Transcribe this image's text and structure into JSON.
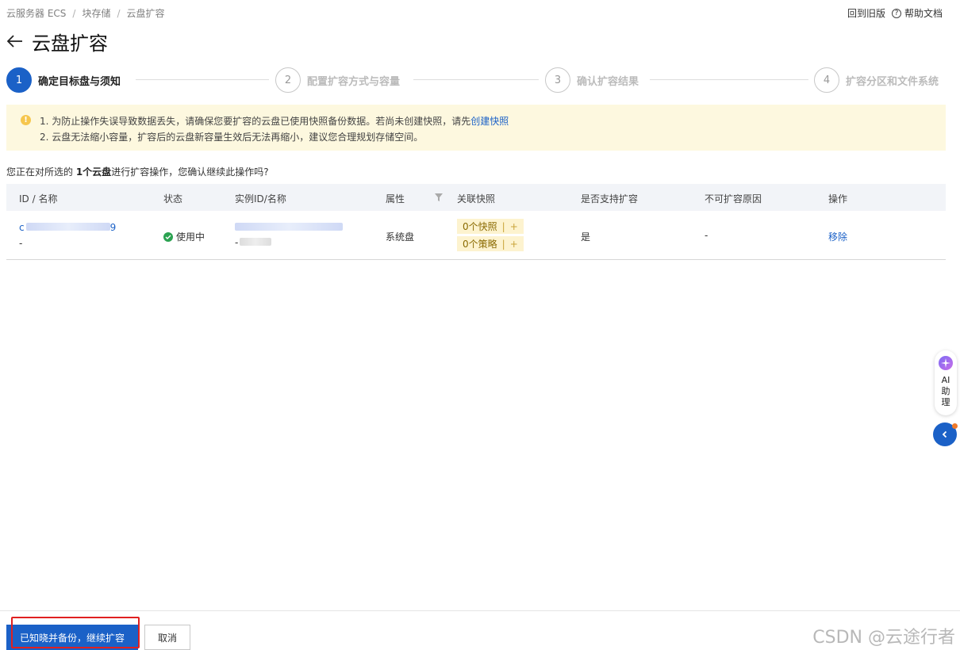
{
  "breadcrumb": [
    "云服务器 ECS",
    "块存储",
    "云盘扩容"
  ],
  "top_links": {
    "old_version": "回到旧版",
    "help_docs": "帮助文档"
  },
  "page_title": "云盘扩容",
  "steps": [
    {
      "num": "1",
      "label": "确定目标盘与须知"
    },
    {
      "num": "2",
      "label": "配置扩容方式与容量"
    },
    {
      "num": "3",
      "label": "确认扩容结果"
    },
    {
      "num": "4",
      "label": "扩容分区和文件系统"
    }
  ],
  "alert": {
    "line1_text": "1. 为防止操作失误导致数据丢失，请确保您要扩容的云盘已使用快照备份数据。若尚未创建快照，请先",
    "line1_link": "创建快照",
    "line2_text": "2. 云盘无法缩小容量，扩容后的云盘新容量生效后无法再缩小，建议您合理规划存储空间。"
  },
  "confirm": {
    "prefix": "您正在对所选的 ",
    "count": "1个云盘",
    "suffix": "进行扩容操作，您确认继续此操作吗?"
  },
  "table": {
    "headers": [
      "ID / 名称",
      "状态",
      "实例ID/名称",
      "属性",
      "关联快照",
      "是否支持扩容",
      "不可扩容原因",
      "操作"
    ],
    "rows": [
      {
        "id_prefix": "c",
        "id_suffix": "9",
        "name": "-",
        "status": "使用中",
        "instance_prefix": "-",
        "attribute": "系统盘",
        "snapshot_count": "0个快照",
        "policy_count": "0个策略",
        "plus": "+",
        "expandable": "是",
        "reason": "-",
        "action": "移除"
      }
    ]
  },
  "ai_assistant": {
    "line1": "AI",
    "line2": "助",
    "line3": "理"
  },
  "buttons": {
    "confirm": "已知晓并备份，继续扩容",
    "cancel": "取消"
  },
  "watermark": "CSDN @云途行者",
  "colors": {
    "primary": "#1b61c7",
    "alert_bg": "#fdf8df",
    "status_green": "#2ba251",
    "highlight_red": "#e02020"
  }
}
